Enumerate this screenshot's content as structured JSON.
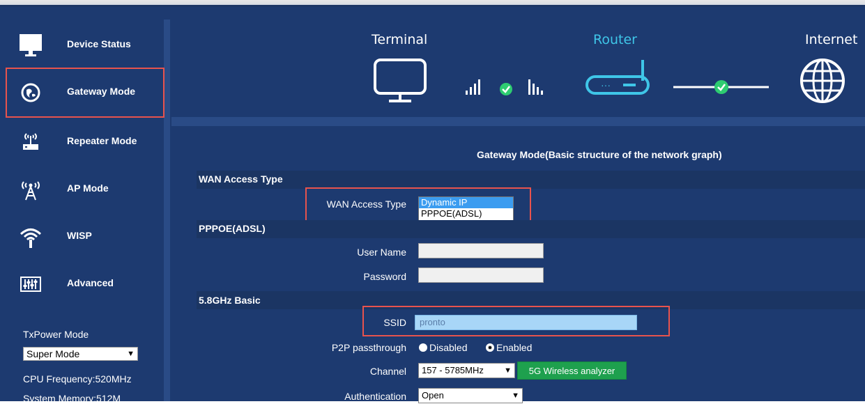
{
  "sidebar": {
    "items": [
      {
        "label": "Device Status",
        "icon": "monitor-icon"
      },
      {
        "label": "Gateway Mode",
        "icon": "globe-icon",
        "active": true
      },
      {
        "label": "Repeater Mode",
        "icon": "repeater-icon"
      },
      {
        "label": "AP Mode",
        "icon": "antenna-icon"
      },
      {
        "label": "WISP",
        "icon": "wifi-icon"
      },
      {
        "label": "Advanced",
        "icon": "equalizer-icon"
      }
    ],
    "txpower_label": "TxPower Mode",
    "txpower_value": "Super Mode",
    "cpu_frequency": "CPU Frequency:520MHz",
    "system_memory": "System Memory:512M"
  },
  "topology": {
    "terminal_label": "Terminal",
    "router_label": "Router",
    "internet_label": "Internet"
  },
  "page": {
    "heading": "Gateway Mode(Basic structure of the network graph)"
  },
  "wan": {
    "section_title": "WAN Access Type",
    "field_label": "WAN Access Type",
    "options": [
      "Dynamic IP",
      "PPPOE(ADSL)"
    ],
    "selected": "Dynamic IP"
  },
  "pppoe": {
    "section_title": "PPPOE(ADSL)",
    "username_label": "User Name",
    "username_value": "",
    "password_label": "Password",
    "password_value": ""
  },
  "basic58": {
    "section_title": "5.8GHz Basic",
    "ssid_label": "SSID",
    "ssid_value": "pronto",
    "p2p_label": "P2P passthrough",
    "p2p_disabled": "Disabled",
    "p2p_enabled": "Enabled",
    "p2p_selected": "Enabled",
    "channel_label": "Channel",
    "channel_value": "157 - 5785MHz",
    "analyzer_button": "5G Wireless analyzer",
    "auth_label": "Authentication",
    "auth_value": "Open"
  },
  "colors": {
    "panel": "#1d3a70",
    "highlight": "#e8534d",
    "accent": "#3fc6e8",
    "check": "#2ecc71",
    "button": "#1ea04e"
  }
}
